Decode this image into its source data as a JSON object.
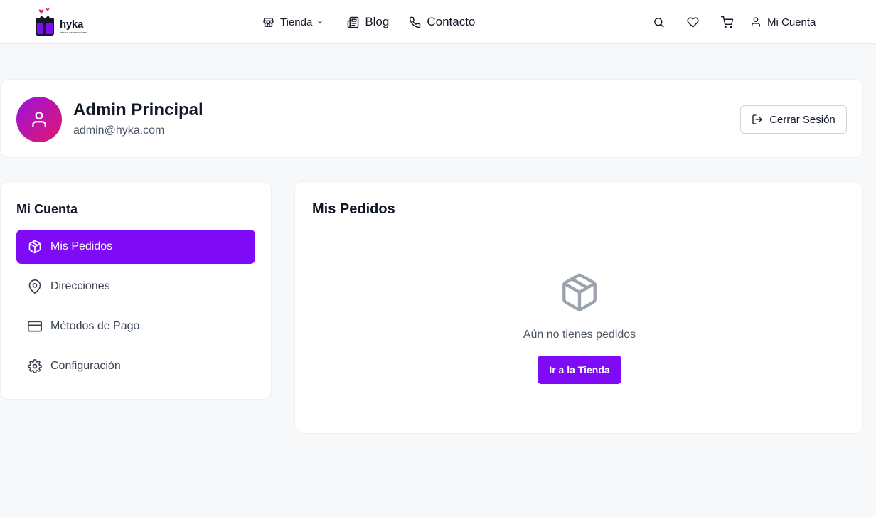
{
  "header": {
    "brand": "hyka",
    "brand_tagline": "fabrica de emociones",
    "nav": [
      {
        "label": "Tienda",
        "icon": "store-icon"
      },
      {
        "label": "Blog",
        "icon": "newspaper-icon"
      },
      {
        "label": "Contacto",
        "icon": "phone-icon"
      }
    ],
    "icons": [
      "search-icon",
      "heart-icon",
      "cart-icon"
    ],
    "account_label": "Mi Cuenta"
  },
  "profile": {
    "name": "Admin Principal",
    "email": "admin@hyka.com",
    "logout_label": "Cerrar Sesión"
  },
  "sidebar": {
    "title": "Mi Cuenta",
    "items": [
      {
        "label": "Mis Pedidos",
        "icon": "package-icon",
        "active": true
      },
      {
        "label": "Direcciones",
        "icon": "map-pin-icon",
        "active": false
      },
      {
        "label": "Métodos de Pago",
        "icon": "credit-card-icon",
        "active": false
      },
      {
        "label": "Configuración",
        "icon": "gear-icon",
        "active": false
      }
    ]
  },
  "main": {
    "title": "Mis Pedidos",
    "empty_text": "Aún no tienes pedidos",
    "cta_label": "Ir a la Tienda"
  },
  "colors": {
    "accent": "#7f0af5",
    "avatar_gradient_start": "#9b12e0",
    "avatar_gradient_end": "#e0176b",
    "background": "#f7f8fa"
  }
}
